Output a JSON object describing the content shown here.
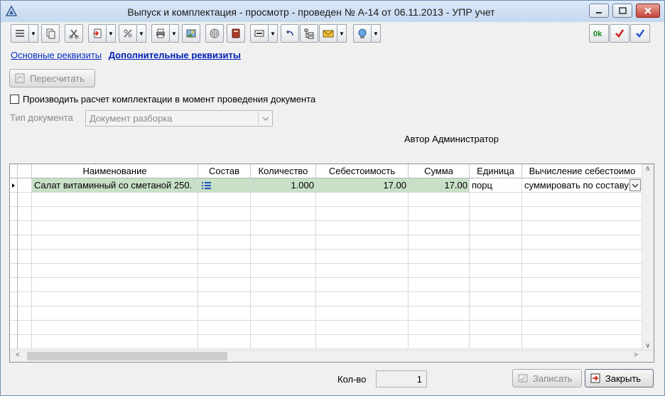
{
  "window": {
    "title": "Выпуск и комплектация - просмотр - проведен № А-14 от 06.11.2013 - УПР учет"
  },
  "tabs": [
    {
      "label": "Основные реквизиты",
      "active": false
    },
    {
      "label": "Дополнительные реквизиты",
      "active": true
    }
  ],
  "recalc_label": "Пересчитать",
  "checkbox": {
    "label": "Производить расчет комплектации в момент проведения документа",
    "checked": false
  },
  "doc_type": {
    "label": "Тип документа",
    "value": "Документ разборка"
  },
  "author": "Автор Администратор",
  "grid": {
    "columns": [
      "Наименование",
      "Состав",
      "Количество",
      "Себестоимость",
      "Сумма",
      "Единица",
      "Вычисление себестоимо"
    ],
    "rows": [
      {
        "name": "Салат витаминный со сметаной 250.",
        "qty": "1.000",
        "cost": "17.00",
        "sum": "17.00",
        "unit": "порц",
        "calc": "суммировать по составу"
      }
    ]
  },
  "footer": {
    "count_label": "Кол-во",
    "count_value": "1",
    "save_label": "Записать",
    "close_label": "Закрыть"
  },
  "colors": {
    "selected_row": "#c8e0c6",
    "link": "#0b2fc2"
  }
}
